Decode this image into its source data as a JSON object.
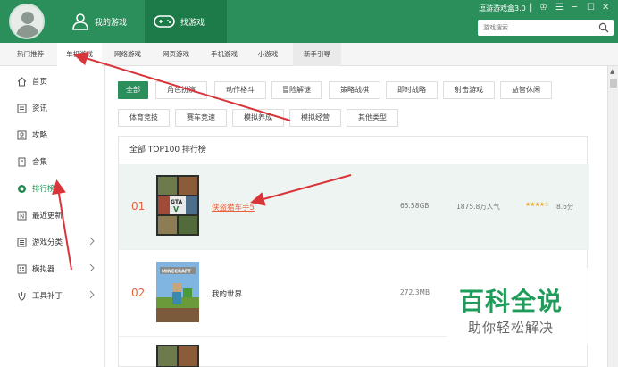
{
  "header": {
    "tabs": [
      {
        "label": "我的游戏",
        "icon": "user-icon"
      },
      {
        "label": "找游戏",
        "icon": "gamepad-icon"
      }
    ],
    "brand": "逗游游戏盒3.0",
    "window_controls": [
      "|",
      "♔",
      "☰",
      "─",
      "☐",
      "✕"
    ],
    "search_placeholder": "游戏搜索"
  },
  "subnav": {
    "items": [
      "热门推荐",
      "单机游戏",
      "网络游戏",
      "网页游戏",
      "手机游戏",
      "小游戏",
      "新手引导"
    ],
    "active_index": 1
  },
  "sidebar": {
    "items": [
      {
        "label": "首页",
        "icon": "home-icon"
      },
      {
        "label": "资讯",
        "icon": "news-icon"
      },
      {
        "label": "攻略",
        "icon": "guide-icon"
      },
      {
        "label": "合集",
        "icon": "collection-icon"
      },
      {
        "label": "排行榜",
        "icon": "ranking-icon",
        "active": true
      },
      {
        "label": "最近更新",
        "icon": "update-icon"
      },
      {
        "label": "游戏分类",
        "icon": "category-icon",
        "has_chevron": true
      },
      {
        "label": "模拟器",
        "icon": "emulator-icon",
        "has_chevron": true
      },
      {
        "label": "工具补丁",
        "icon": "tools-icon",
        "has_chevron": true
      }
    ]
  },
  "filters": {
    "row1": [
      "全部",
      "角色扮演",
      "动作格斗",
      "冒险解谜",
      "策略战棋",
      "即时战略",
      "射击游戏",
      "益智休闲"
    ],
    "row2": [
      "体育竞技",
      "赛车竞速",
      "模拟养成",
      "模拟经营",
      "其他类型"
    ],
    "active": "全部"
  },
  "ranking": {
    "title": "全部 TOP100 排行榜",
    "rows": [
      {
        "rank": "01",
        "name": "侠盗猎车手5",
        "size": "65.58GB",
        "popularity": "1875.8万人气",
        "stars": "★★★★☆",
        "score": "8.6分"
      },
      {
        "rank": "02",
        "name": "我的世界",
        "size": "272.3MB",
        "popularity": "",
        "stars": "",
        "score": ""
      }
    ]
  },
  "watermark": {
    "title": "百科全说",
    "subtitle": "助你轻松解决"
  },
  "colors": {
    "brand_green": "#2a8f5b",
    "rank_orange": "#e8603c",
    "arrow_red": "#d9343a"
  }
}
